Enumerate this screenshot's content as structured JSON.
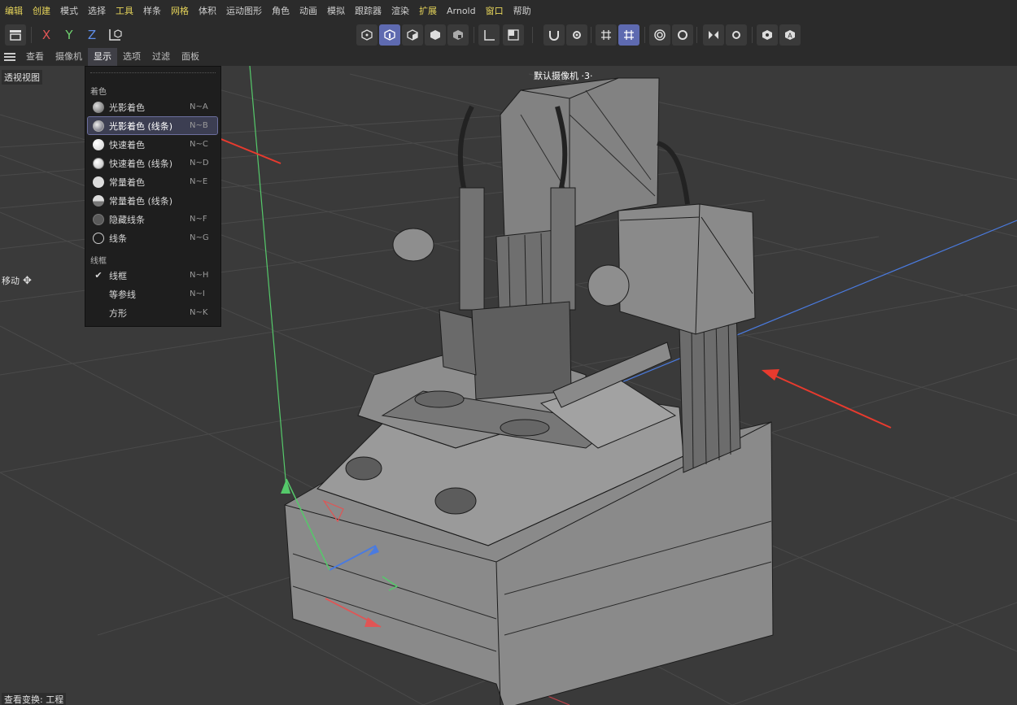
{
  "menu": [
    "编辑",
    "创建",
    "模式",
    "选择",
    "工具",
    "样条",
    "网格",
    "体积",
    "运动图形",
    "角色",
    "动画",
    "模拟",
    "跟踪器",
    "渲染",
    "扩展",
    "Arnold",
    "窗口",
    "帮助"
  ],
  "toolbar": {
    "x": "X",
    "y": "Y",
    "z": "Z"
  },
  "viewport_menu": [
    "查看",
    "摄像机",
    "显示",
    "选项",
    "过滤",
    "面板"
  ],
  "viewport": {
    "name": "透视视图",
    "camera": "默认摄像机 ·3·",
    "move_label": "移动",
    "status": "查看变换: 工程"
  },
  "dropdown": {
    "section_shading": "着色",
    "section_wire": "线框",
    "items": [
      {
        "label": "光影着色",
        "shortcut": "N~A"
      },
      {
        "label": "光影着色 (线条)",
        "shortcut": "N~B"
      },
      {
        "label": "快速着色",
        "shortcut": "N~C"
      },
      {
        "label": "快速着色 (线条)",
        "shortcut": "N~D"
      },
      {
        "label": "常量着色",
        "shortcut": "N~E"
      },
      {
        "label": "常量着色 (线条)",
        "shortcut": ""
      },
      {
        "label": "隐藏线条",
        "shortcut": "N~F"
      },
      {
        "label": "线条",
        "shortcut": "N~G"
      }
    ],
    "wire_items": [
      {
        "label": "线框",
        "shortcut": "N~H",
        "checked": true
      },
      {
        "label": "等参线",
        "shortcut": "N~I",
        "checked": false
      },
      {
        "label": "方形",
        "shortcut": "N~K",
        "checked": false
      }
    ]
  },
  "colors": {
    "accent": "#5e6ab0",
    "menu_highlight": "#e6d45a",
    "axis_x": "#e05555",
    "axis_y": "#6fd26f",
    "axis_z": "#5f8ee8",
    "annotation_arrow": "#e83a2e"
  }
}
